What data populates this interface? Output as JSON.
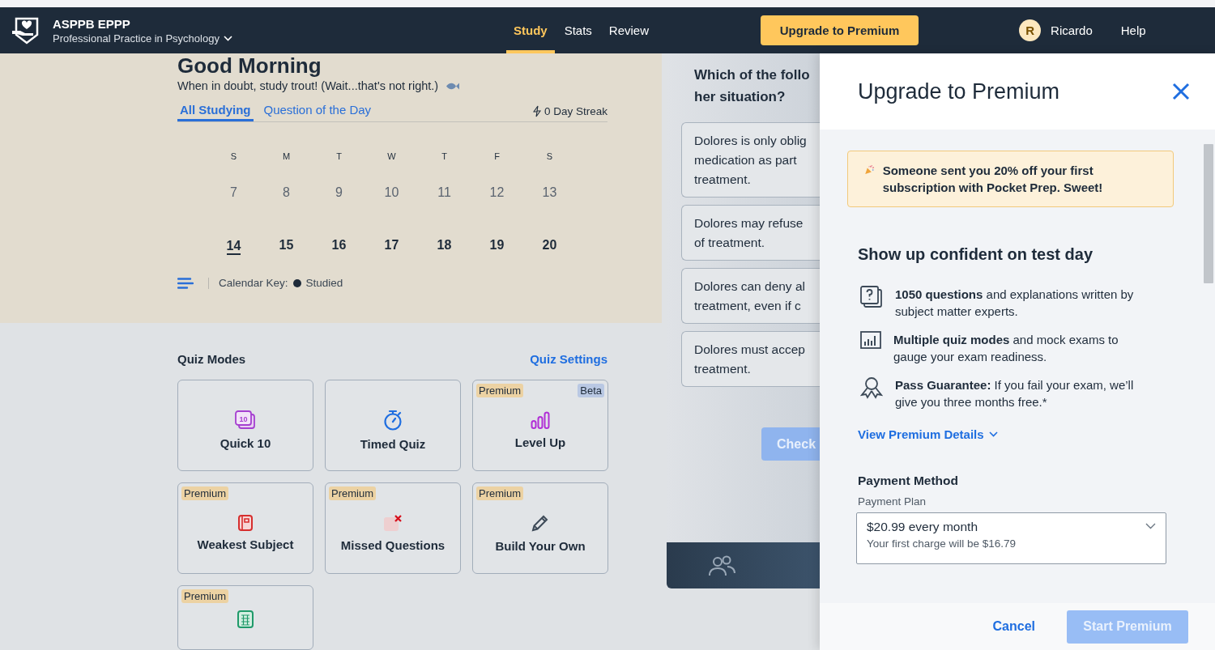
{
  "header": {
    "app_name": "ASPPB EPPP",
    "exam_name": "Professional Practice in Psychology",
    "nav": [
      {
        "label": "Study",
        "selected": true
      },
      {
        "label": "Stats",
        "selected": false
      },
      {
        "label": "Review",
        "selected": false
      }
    ],
    "upgrade_button": "Upgrade to Premium",
    "user_initial": "R",
    "user_name": "Ricardo",
    "help": "Help"
  },
  "study": {
    "greeting": "Good Morning",
    "tagline": "When in doubt, study trout! (Wait...that's not right.)",
    "tabs": [
      {
        "label": "All Studying",
        "selected": true
      },
      {
        "label": "Question of the Day",
        "selected": false
      }
    ],
    "streak": "0 Day Streak",
    "weekdays": [
      "S",
      "M",
      "T",
      "W",
      "T",
      "F",
      "S"
    ],
    "weeks": [
      [
        {
          "day": "7",
          "past": true,
          "today": false
        },
        {
          "day": "8",
          "past": true,
          "today": false
        },
        {
          "day": "9",
          "past": true,
          "today": false
        },
        {
          "day": "10",
          "past": true,
          "today": false
        },
        {
          "day": "11",
          "past": true,
          "today": false
        },
        {
          "day": "12",
          "past": true,
          "today": false
        },
        {
          "day": "13",
          "past": true,
          "today": false
        }
      ],
      [
        {
          "day": "14",
          "past": false,
          "today": true
        },
        {
          "day": "15",
          "past": false,
          "today": false
        },
        {
          "day": "16",
          "past": false,
          "today": false
        },
        {
          "day": "17",
          "past": false,
          "today": false
        },
        {
          "day": "18",
          "past": false,
          "today": false
        },
        {
          "day": "19",
          "past": false,
          "today": false
        },
        {
          "day": "20",
          "past": false,
          "today": false
        }
      ]
    ],
    "calendar_key_label": "Calendar Key:",
    "key_items": [
      {
        "label": "Studied",
        "color": "#1e2b3a"
      }
    ]
  },
  "quiz_modes": {
    "title": "Quiz Modes",
    "settings_link": "Quiz Settings",
    "modes": [
      {
        "kind": "quick10",
        "label": "Quick 10",
        "icon_text": "10"
      },
      {
        "kind": "timed",
        "label": "Timed Quiz"
      },
      {
        "kind": "levelup",
        "label": "Level Up",
        "badges": [
          {
            "kind": "premium",
            "label": "Premium"
          },
          {
            "kind": "beta",
            "label": "Beta"
          }
        ]
      },
      {
        "kind": "weakest",
        "label": "Weakest Subject",
        "badges": [
          {
            "kind": "premium",
            "label": "Premium"
          }
        ]
      },
      {
        "kind": "missed",
        "label": "Missed Questions",
        "badges": [
          {
            "kind": "premium",
            "label": "Premium"
          }
        ]
      },
      {
        "kind": "build",
        "label": "Build Your Own",
        "badges": [
          {
            "kind": "premium",
            "label": "Premium"
          }
        ]
      },
      {
        "kind": "mock",
        "badges": [
          {
            "kind": "premium",
            "label": "Premium"
          }
        ]
      }
    ]
  },
  "question": {
    "lines": [
      "Which of the follo",
      "her situation?"
    ],
    "options": [
      {
        "lines": [
          "Dolores is only oblig",
          "medication as part",
          "treatment."
        ]
      },
      {
        "lines": [
          "Dolores may refuse",
          "of treatment."
        ]
      },
      {
        "lines": [
          "Dolores can deny al",
          "treatment, even if c"
        ]
      },
      {
        "lines": [
          "Dolores must accep",
          "treatment."
        ]
      }
    ],
    "check_button": "Check"
  },
  "drawer": {
    "title": "Upgrade to Premium",
    "promo": "Someone sent you 20% off your first subscription with Pocket Prep. Sweet!",
    "heading": "Show up confident on test day",
    "features": [
      {
        "kind": "questions",
        "text": "**1050 questions** and explanations written by subject matter experts."
      },
      {
        "kind": "modes",
        "text": "**Multiple quiz modes** and mock exams to gauge your exam readiness."
      },
      {
        "kind": "guarantee",
        "text": "**Pass Guarantee:** If you fail your exam, we’ll give you three months free.*"
      }
    ],
    "details_link": "View Premium Details",
    "payment_title": "Payment Method",
    "plan_label": "Payment Plan",
    "plan_value": "$20.99 every month",
    "plan_note": "Your first charge will be $16.79",
    "cancel": "Cancel",
    "start": {
      "label": "Start Premium",
      "disabled": true
    }
  }
}
